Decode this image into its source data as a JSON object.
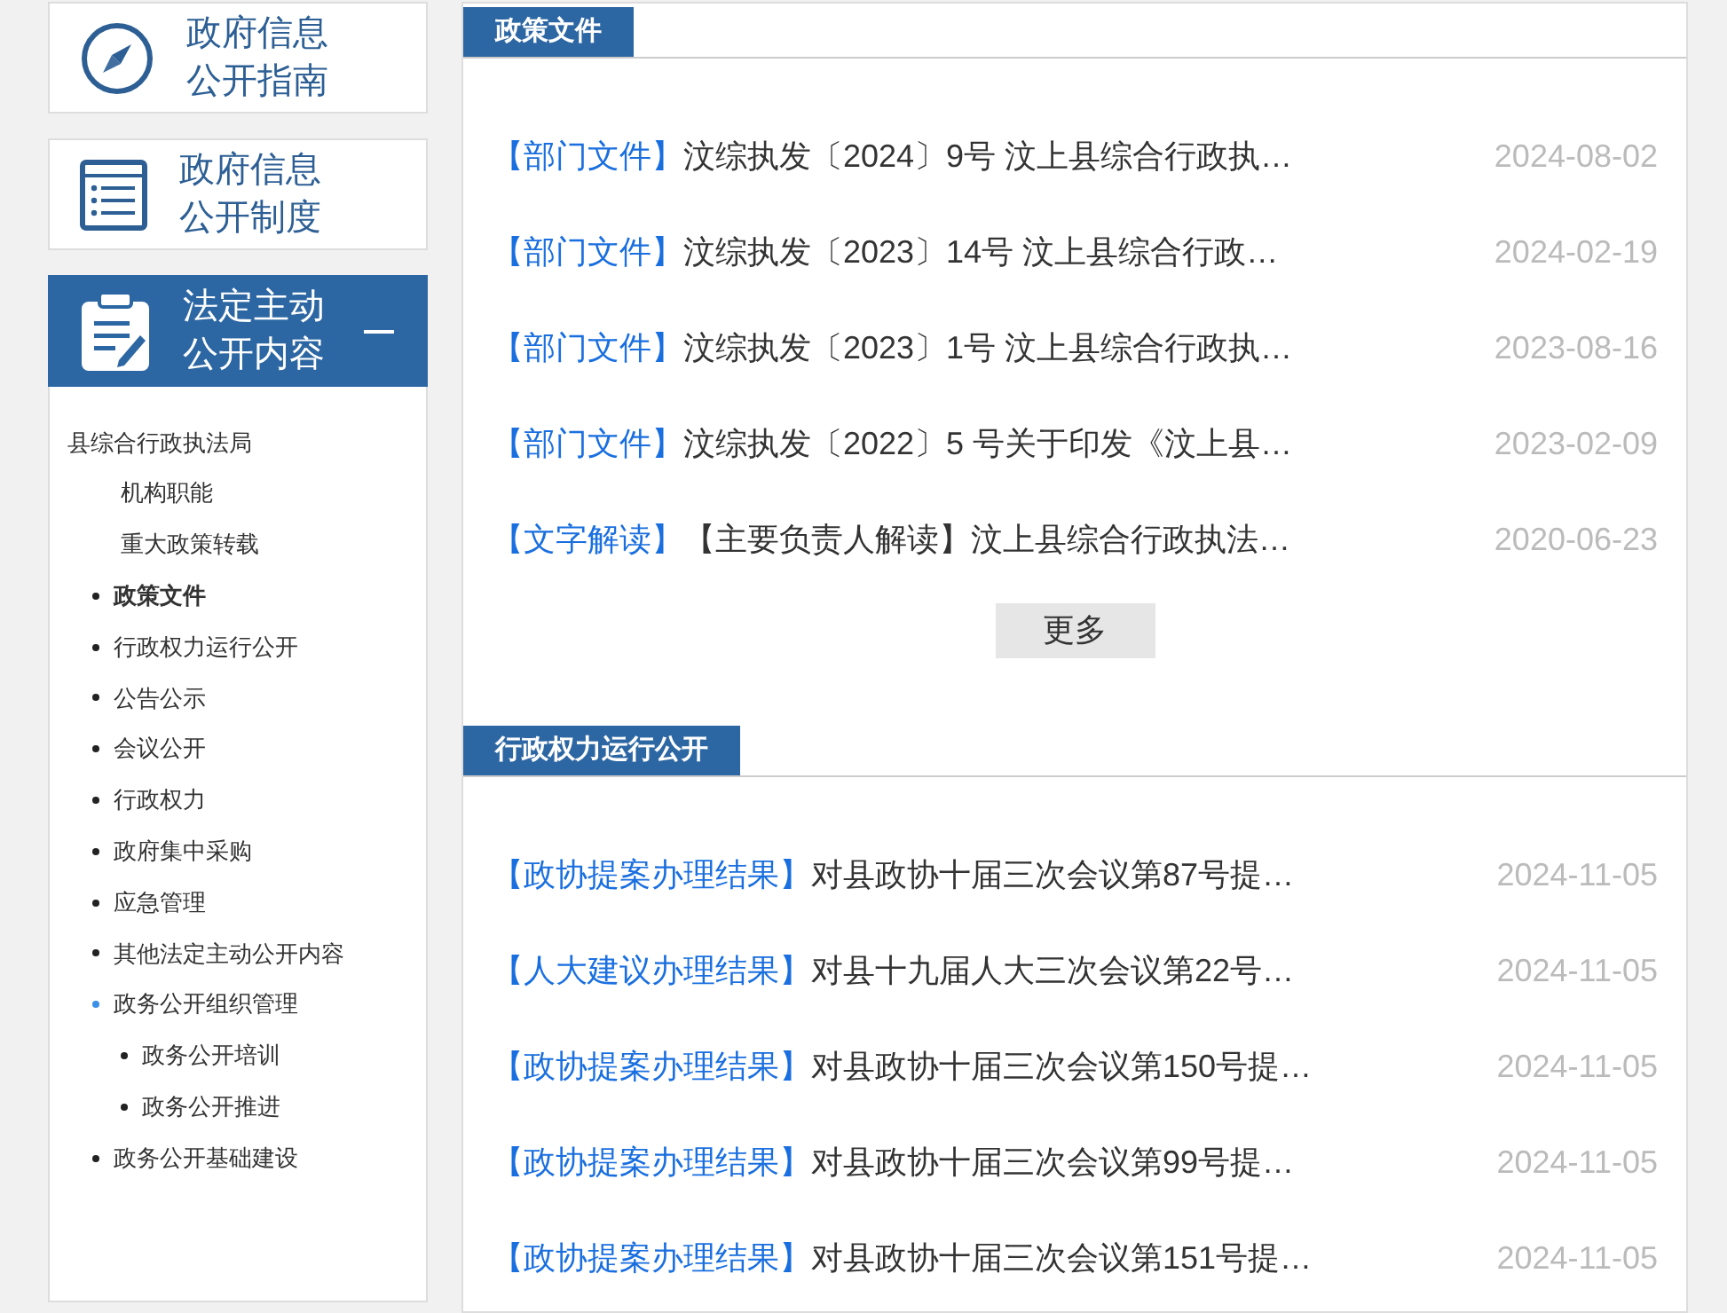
{
  "nav_cards": [
    {
      "lines": [
        "政府信息",
        "公开指南"
      ],
      "selected": false
    },
    {
      "lines": [
        "政府信息",
        "公开制度"
      ],
      "selected": false
    },
    {
      "lines": [
        "法定主动",
        "公开内容"
      ],
      "selected": true
    }
  ],
  "tree": [
    {
      "label": "县综合行政执法局",
      "selected": false,
      "children": [
        {
          "label": "机构职能",
          "kind": "plain",
          "selected": false
        },
        {
          "label": "重大政策转载",
          "kind": "plain",
          "selected": false
        },
        {
          "label": "政策文件",
          "kind": "bullet",
          "selected": true
        },
        {
          "label": "行政权力运行公开",
          "kind": "bullet",
          "selected": false
        },
        {
          "label": "公告公示",
          "kind": "bullet",
          "selected": false
        },
        {
          "label": "会议公开",
          "kind": "bullet",
          "selected": false
        },
        {
          "label": "行政权力",
          "kind": "bullet",
          "selected": false
        },
        {
          "label": "政府集中采购",
          "kind": "bullet",
          "selected": false
        },
        {
          "label": "应急管理",
          "kind": "bullet",
          "selected": false
        },
        {
          "label": "其他法定主动公开内容",
          "kind": "bullet",
          "selected": false
        },
        {
          "label": "政务公开组织管理",
          "kind": "bullet",
          "selected": false,
          "expanded": true,
          "children": [
            {
              "label": "政务公开培训",
              "kind": "bullet",
              "selected": false
            },
            {
              "label": "政务公开推进",
              "kind": "bullet",
              "selected": false
            }
          ]
        },
        {
          "label": "政务公开基础建设",
          "kind": "bullet",
          "selected": false
        }
      ]
    }
  ],
  "sections": [
    {
      "title": "政策文件",
      "items": [
        {
          "category": "【部门文件】",
          "title": "汶综执发〔2024〕9号 汶上县综合行政执…",
          "date": "2024-08-02"
        },
        {
          "category": "【部门文件】",
          "title": "汶综执发〔2023〕14号 汶上县综合行政…",
          "date": "2024-02-19"
        },
        {
          "category": "【部门文件】",
          "title": "汶综执发〔2023〕1号 汶上县综合行政执…",
          "date": "2023-08-16"
        },
        {
          "category": "【部门文件】",
          "title": "汶综执发〔2022〕5 号关于印发《汶上县…",
          "date": "2023-02-09"
        },
        {
          "category": "【文字解读】",
          "title": "【主要负责人解读】汶上县综合行政执法…",
          "date": "2020-06-23"
        }
      ],
      "more": "更多"
    },
    {
      "title": "行政权力运行公开",
      "items": [
        {
          "category": "【政协提案办理结果】",
          "title": "对县政协十届三次会议第87号提…",
          "date": "2024-11-05"
        },
        {
          "category": "【人大建议办理结果】",
          "title": "对县十九届人大三次会议第22号…",
          "date": "2024-11-05"
        },
        {
          "category": "【政协提案办理结果】",
          "title": "对县政协十届三次会议第150号提…",
          "date": "2024-11-05"
        },
        {
          "category": "【政协提案办理结果】",
          "title": "对县政协十届三次会议第99号提…",
          "date": "2024-11-05"
        },
        {
          "category": "【政协提案办理结果】",
          "title": "对县政协十届三次会议第151号提…",
          "date": "2024-11-05"
        }
      ]
    }
  ]
}
